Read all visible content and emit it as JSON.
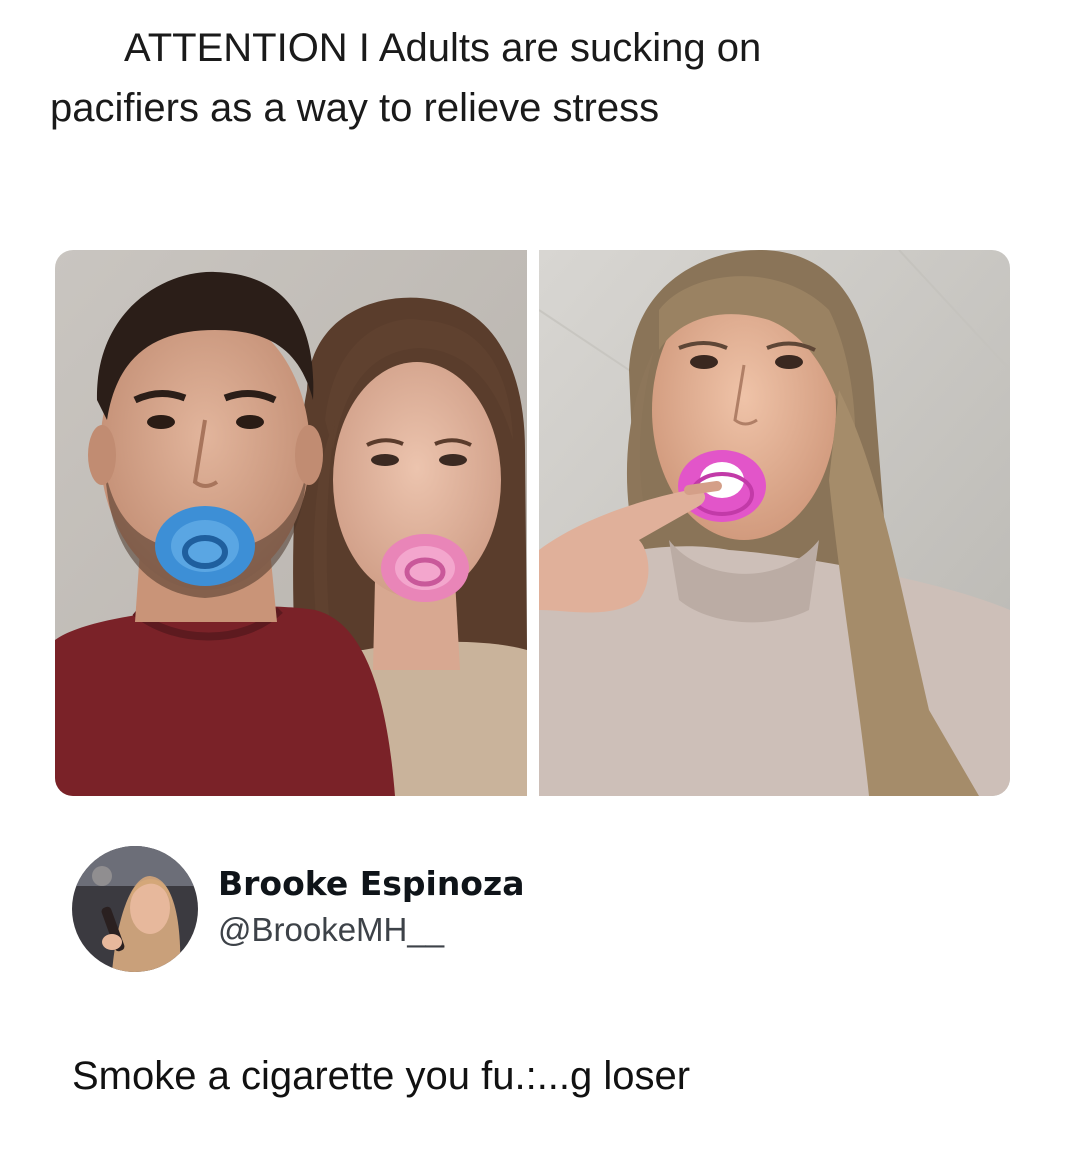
{
  "headline": {
    "line1": "ATTENTION I Adults are sucking on",
    "line2": "pacifiers as a way to relieve stress"
  },
  "media": {
    "left_photo": "couple-with-pacifiers-photo",
    "right_photo": "woman-with-pink-pacifier-photo"
  },
  "colors": {
    "blue_pacifier": "#3d8fd6",
    "pink_pacifier": "#e985b8",
    "magenta_pacifier": "#e255c9",
    "maroon_shirt": "#7a2228",
    "beige_hoodie": "#cdbfb8"
  },
  "tweet": {
    "author_name": "Brooke Espinoza",
    "author_handle": "@BrookeMH__",
    "text": "Smoke a cigarette you fu.:...g loser"
  }
}
